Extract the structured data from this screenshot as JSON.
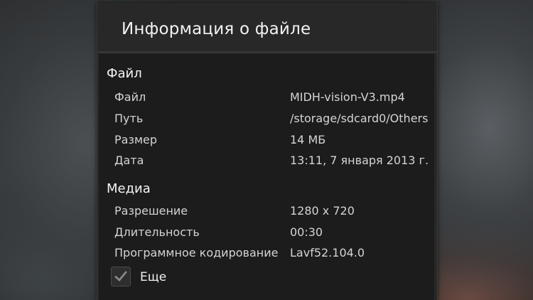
{
  "dialog": {
    "title": "Информация о файле"
  },
  "sections": [
    {
      "header": "Файл",
      "rows": [
        {
          "label": "Файл",
          "value": "MIDH-vision-V3.mp4"
        },
        {
          "label": "Путь",
          "value": "/storage/sdcard0/Others"
        },
        {
          "label": "Размер",
          "value": "14 МБ"
        },
        {
          "label": "Дата",
          "value": "13:11, 7 января 2013 г."
        }
      ]
    },
    {
      "header": "Медиа",
      "rows": [
        {
          "label": "Разрешение",
          "value": "1280 x 720"
        },
        {
          "label": "Длительность",
          "value": "00:30"
        },
        {
          "label": "Программное кодирование",
          "value": "Lavf52.104.0"
        }
      ]
    }
  ],
  "more": {
    "label": "Еще",
    "checked": true
  },
  "colors": {
    "dialog_bg": "#282828",
    "content_bg": "#1c1c1c",
    "text_primary": "#f2f2f2",
    "text_secondary": "#d4d4d4",
    "checkmark": "#8a8a8a"
  }
}
